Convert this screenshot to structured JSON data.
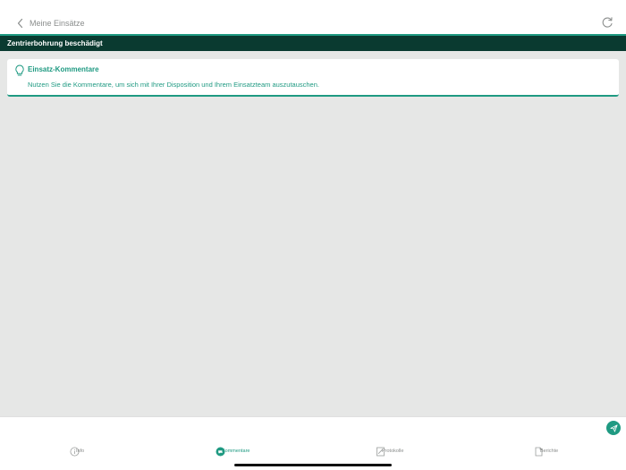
{
  "header": {
    "back_label": "Meine Einsätze",
    "title": "Zentrierbohrung beschädigt"
  },
  "info_card": {
    "title": "Einsatz-Kommentare",
    "text": "Nutzen Sie die Kommentare, um sich mit Ihrer Disposition und Ihrem Einsatzteam auszutauschen."
  },
  "composer": {
    "placeholder": "",
    "value": ""
  },
  "tabs": [
    {
      "label": "Info",
      "icon": "info-icon",
      "active": false
    },
    {
      "label": "Kommentare",
      "icon": "comment-icon",
      "active": true
    },
    {
      "label": "Protokolle",
      "icon": "protocol-icon",
      "active": false
    },
    {
      "label": "Berichte",
      "icon": "report-icon",
      "active": false
    }
  ],
  "colors": {
    "accent": "#1f9a82",
    "title_bar": "#0a3a30",
    "content_bg": "#e6e7e6"
  }
}
